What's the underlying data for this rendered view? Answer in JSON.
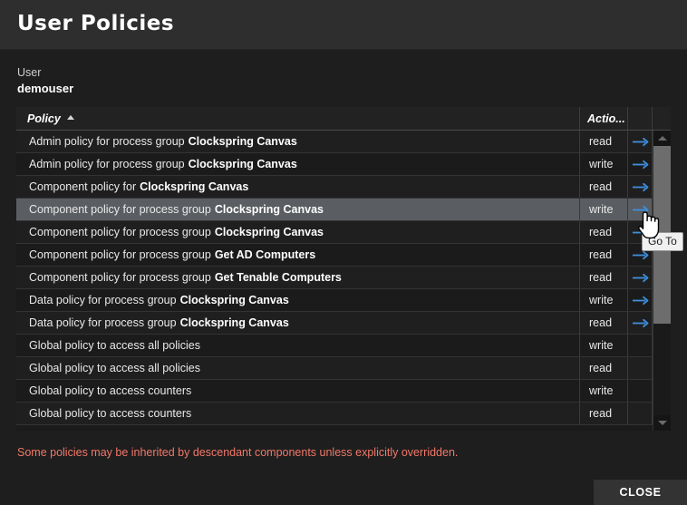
{
  "window": {
    "title": "User Policies"
  },
  "user": {
    "label": "User",
    "name": "demouser"
  },
  "table": {
    "columns": {
      "policy": "Policy",
      "action": "Actio...",
      "goto": ""
    },
    "sort": {
      "column": "Policy",
      "direction": "ascending"
    },
    "rows": [
      {
        "policy_prefix": "Admin policy for process group",
        "policy_bold": "Clockspring Canvas",
        "action": "read",
        "goto": "arrow-right-icon",
        "selected": false
      },
      {
        "policy_prefix": "Admin policy for process group",
        "policy_bold": "Clockspring Canvas",
        "action": "write",
        "goto": "arrow-right-icon",
        "selected": false
      },
      {
        "policy_prefix": "Component policy for",
        "policy_bold": "Clockspring Canvas",
        "action": "read",
        "goto": "arrow-right-icon",
        "selected": false
      },
      {
        "policy_prefix": "Component policy for process group",
        "policy_bold": "Clockspring Canvas",
        "action": "write",
        "goto": "arrow-right-icon",
        "selected": true
      },
      {
        "policy_prefix": "Component policy for process group",
        "policy_bold": "Clockspring Canvas",
        "action": "read",
        "goto": "arrow-right-icon",
        "selected": false
      },
      {
        "policy_prefix": "Component policy for process group",
        "policy_bold": "Get AD Computers",
        "action": "read",
        "goto": "arrow-right-icon",
        "selected": false
      },
      {
        "policy_prefix": "Component policy for process group",
        "policy_bold": "Get Tenable Computers",
        "action": "read",
        "goto": "arrow-right-icon",
        "selected": false
      },
      {
        "policy_prefix": "Data policy for process group",
        "policy_bold": "Clockspring Canvas",
        "action": "write",
        "goto": "arrow-right-icon",
        "selected": false
      },
      {
        "policy_prefix": "Data policy for process group",
        "policy_bold": "Clockspring Canvas",
        "action": "read",
        "goto": "arrow-right-icon",
        "selected": false
      },
      {
        "policy_prefix": "Global policy to access all policies",
        "policy_bold": "",
        "action": "write",
        "goto": "",
        "selected": false
      },
      {
        "policy_prefix": "Global policy to access all policies",
        "policy_bold": "",
        "action": "read",
        "goto": "",
        "selected": false
      },
      {
        "policy_prefix": "Global policy to access counters",
        "policy_bold": "",
        "action": "write",
        "goto": "",
        "selected": false
      },
      {
        "policy_prefix": "Global policy to access counters",
        "policy_bold": "",
        "action": "read",
        "goto": "",
        "selected": false
      }
    ]
  },
  "scrollbar": {
    "up_icon": "chevron-up-icon",
    "down_icon": "chevron-down-icon"
  },
  "tooltip": {
    "text": "Go To"
  },
  "footer": {
    "warning": "Some policies may be inherited by descendant components unless explicitly overridden.",
    "close_label": "CLOSE"
  },
  "colors": {
    "accent_arrow": "#3f8fdc",
    "warning_text": "#f2786a",
    "selected_row": "#5a5d61",
    "header_bar": "#2e2e2e",
    "body_bg": "#1e1e1e"
  }
}
